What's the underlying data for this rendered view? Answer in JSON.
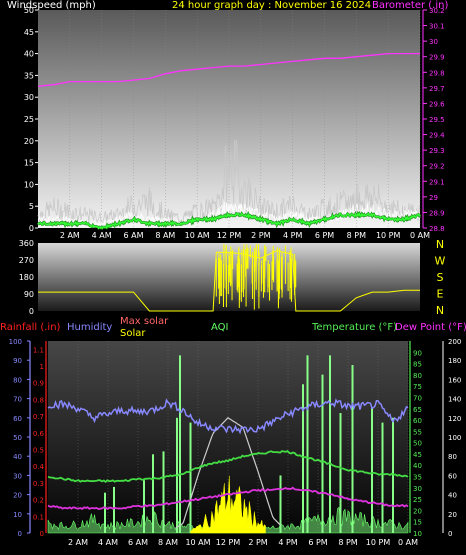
{
  "colors": {
    "wind": "#ffffff",
    "gust": "#c8c8c8",
    "avgwind": "#33ff33",
    "baro": "#ff33ff",
    "dir": "#ffff00",
    "rain": "#ff2020",
    "humidity": "#8888ff",
    "maxsolar": "#cccccc",
    "solar": "#ffff00",
    "aqi": "#66ff66",
    "temp": "#44dd44",
    "dew": "#dd33dd",
    "titlecolor": "#ffff00",
    "fgwhite": "#ffffff",
    "axisgreen": "#55ee55",
    "axiswhite": "#ffffff"
  },
  "chart_data": [
    {
      "type": "line",
      "title": "24 hour graph day : November 16 2024",
      "ylabel_left": "Windspeed (mph)",
      "ylabel_right": "Barometer (.in)",
      "x_ticks": [
        "2 AM",
        "4 AM",
        "6 AM",
        "8 AM",
        "10 AM",
        "12 PM",
        "2 PM",
        "4 PM",
        "6 PM",
        "8 PM",
        "10 PM",
        "0 AM"
      ],
      "ylim_left": [
        0,
        50
      ],
      "y_ticks_left": [
        "0",
        "5",
        "10",
        "15",
        "20",
        "25",
        "30",
        "35",
        "40",
        "45",
        "50"
      ],
      "ylim_right": [
        28.8,
        30.2
      ],
      "y_ticks_right": [
        "28.8",
        "28.9",
        "29",
        "29.1",
        "29.2",
        "29.3",
        "29.4",
        "29.5",
        "29.6",
        "29.7",
        "29.8",
        "29.9",
        "30",
        "30.1",
        "30.2"
      ],
      "hours": [
        0,
        1,
        2,
        3,
        4,
        5,
        6,
        7,
        8,
        9,
        10,
        11,
        12,
        13,
        14,
        15,
        16,
        17,
        18,
        19,
        20,
        21,
        22,
        23,
        24
      ],
      "series": [
        {
          "name": "gust",
          "values": [
            4,
            6,
            5,
            4,
            3,
            4,
            7,
            8,
            4,
            3,
            5,
            6,
            14,
            12,
            6,
            5,
            7,
            4,
            6,
            7,
            9,
            10,
            6,
            5,
            5
          ]
        },
        {
          "name": "wind",
          "values": [
            2,
            2,
            2,
            1,
            1,
            2,
            3,
            2,
            2,
            1,
            2,
            3,
            5,
            4,
            3,
            2,
            3,
            2,
            2,
            3,
            4,
            4,
            3,
            3,
            3
          ]
        },
        {
          "name": "average",
          "values": [
            1,
            1,
            1,
            1,
            0,
            1,
            2,
            1,
            1,
            1,
            2,
            2,
            3,
            3,
            2,
            1,
            2,
            1,
            2,
            3,
            3,
            3,
            2,
            2,
            3
          ]
        },
        {
          "name": "barometer",
          "values": [
            29.71,
            29.72,
            29.74,
            29.74,
            29.74,
            29.74,
            29.75,
            29.76,
            29.79,
            29.81,
            29.82,
            29.83,
            29.84,
            29.84,
            29.85,
            29.86,
            29.87,
            29.88,
            29.89,
            29.89,
            29.9,
            29.91,
            29.92,
            29.92,
            29.92
          ]
        }
      ]
    },
    {
      "type": "line",
      "title": "",
      "y_ticks_left": [
        "0",
        "90",
        "180",
        "270",
        "360"
      ],
      "ylim": [
        0,
        360
      ],
      "direction_labels": [
        "N",
        "W",
        "S",
        "E",
        "N"
      ],
      "hours": [
        0,
        1,
        2,
        3,
        4,
        5,
        6,
        7,
        8,
        9,
        10,
        11,
        11.2,
        12,
        13,
        14,
        15,
        16,
        16.2,
        17,
        18,
        19,
        20,
        21,
        22,
        23,
        24
      ],
      "values": [
        100,
        100,
        100,
        100,
        100,
        100,
        100,
        0,
        0,
        0,
        0,
        0,
        310,
        310,
        300,
        280,
        320,
        300,
        0,
        0,
        0,
        0,
        70,
        100,
        100,
        110,
        110
      ]
    },
    {
      "type": "line",
      "labels": {
        "rainfall": "Rainfall (.in)",
        "humidity": "Humidity",
        "maxsolar": "Max solar",
        "solar": "Solar",
        "aqi": "AQI",
        "temp": "Temperature (°F)",
        "dew": "Dew Point (°F)"
      },
      "x_ticks": [
        "2 AM",
        "4 AM",
        "6 AM",
        "8 AM",
        "10 AM",
        "12 PM",
        "2 PM",
        "4 PM",
        "6 PM",
        "8 PM",
        "10 PM",
        "0 AM"
      ],
      "ticks_rain": [
        "0",
        "0.1",
        "0.2",
        "0.3",
        "0.4",
        "0.5",
        "0.6",
        "0.7",
        "0.8",
        "0.9",
        "1",
        "1.1"
      ],
      "ticks_humidity": [
        "0",
        "10",
        "20",
        "30",
        "40",
        "50",
        "60",
        "70",
        "80",
        "90",
        "100"
      ],
      "ticks_temp": [
        "10",
        "15",
        "20",
        "25",
        "30",
        "35",
        "40",
        "45",
        "50",
        "55",
        "60",
        "65",
        "70",
        "75",
        "80",
        "85",
        "90"
      ],
      "ticks_aqi": [
        "0",
        "20",
        "40",
        "60",
        "80",
        "100",
        "120",
        "140",
        "160",
        "180",
        "200"
      ],
      "ylim_temp": [
        10,
        95
      ],
      "ylim_humidity": [
        0,
        100
      ],
      "hours": [
        0,
        1,
        2,
        3,
        4,
        5,
        6,
        7,
        8,
        9,
        10,
        11,
        12,
        13,
        14,
        15,
        16,
        17,
        18,
        19,
        20,
        21,
        22,
        23,
        24
      ],
      "series": [
        {
          "name": "Humidity",
          "values": [
            67,
            67,
            65,
            60,
            62,
            64,
            63,
            64,
            68,
            64,
            57,
            55,
            54,
            54,
            54,
            58,
            62,
            65,
            67,
            68,
            66,
            66,
            67,
            58,
            65
          ]
        },
        {
          "name": "Temperature",
          "values": [
            35,
            34,
            33,
            33,
            33,
            33,
            34,
            34,
            35,
            36,
            39,
            41,
            42,
            44,
            45,
            46,
            46,
            44,
            42,
            40,
            38,
            37,
            36,
            36,
            35
          ]
        },
        {
          "name": "Dew Point",
          "values": [
            22,
            21,
            21,
            21,
            21,
            21,
            22,
            22,
            23,
            24,
            25,
            26,
            27,
            28,
            29,
            29,
            30,
            29,
            28,
            27,
            25,
            24,
            23,
            22,
            22
          ]
        },
        {
          "name": "Max solar",
          "values": [
            0,
            0,
            0,
            0,
            0,
            0,
            0,
            0,
            0,
            5,
            30,
            52,
            60,
            55,
            32,
            8,
            0,
            0,
            0,
            0,
            0,
            0,
            0,
            0,
            0
          ]
        },
        {
          "name": "Solar",
          "values": [
            0,
            0,
            0,
            0,
            0,
            0,
            0,
            0,
            0,
            0,
            3,
            10,
            22,
            15,
            6,
            0,
            0,
            0,
            0,
            0,
            0,
            0,
            0,
            0,
            0
          ]
        },
        {
          "name": "AQI",
          "values": [
            12,
            8,
            10,
            15,
            8,
            10,
            12,
            18,
            10,
            8,
            6,
            5,
            6,
            5,
            5,
            6,
            8,
            10,
            15,
            20,
            18,
            15,
            12,
            10,
            8
          ]
        }
      ],
      "aqi_spikes": [
        {
          "x": 3.8,
          "v": 42
        },
        {
          "x": 4.4,
          "v": 48
        },
        {
          "x": 6.4,
          "v": 55
        },
        {
          "x": 7.0,
          "v": 82
        },
        {
          "x": 7.7,
          "v": 85
        },
        {
          "x": 8.6,
          "v": 120
        },
        {
          "x": 8.8,
          "v": 185
        },
        {
          "x": 9.5,
          "v": 115
        },
        {
          "x": 15.5,
          "v": 60
        },
        {
          "x": 17.0,
          "v": 155
        },
        {
          "x": 17.3,
          "v": 185
        },
        {
          "x": 18.3,
          "v": 165
        },
        {
          "x": 18.8,
          "v": 185
        },
        {
          "x": 19.5,
          "v": 125
        },
        {
          "x": 20.3,
          "v": 175
        },
        {
          "x": 21.6,
          "v": 130
        },
        {
          "x": 22.3,
          "v": 115
        },
        {
          "x": 23.0,
          "v": 120
        }
      ]
    }
  ]
}
